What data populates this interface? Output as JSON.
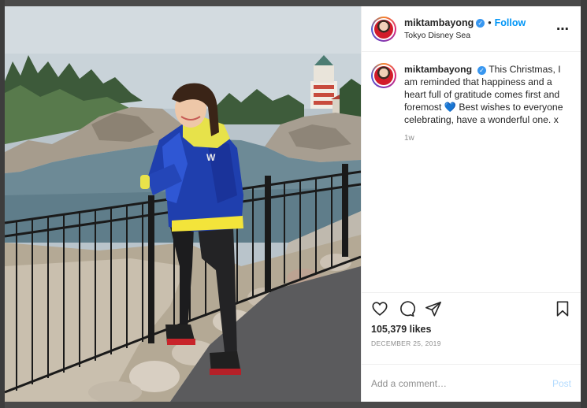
{
  "post": {
    "username": "miktambayong",
    "follow_label": "Follow",
    "location": "Tokyo Disney Sea",
    "more_icon": "more-options-icon",
    "caption_before_emoji": "This Christmas, I am reminded that happiness and a heart full of gratitude comes first and foremost",
    "caption_emoji": "💙",
    "caption_after_emoji": "Best wishes to everyone celebrating, have a wonderful one. x",
    "caption_time": "1w",
    "likes": "105,379 likes",
    "date": "DECEMBER 25, 2019",
    "comment_placeholder": "Add a comment…",
    "post_label": "Post",
    "jacket_text": "W",
    "icons": [
      "heart-icon",
      "comment-icon",
      "share-icon",
      "bookmark-icon"
    ],
    "accent": "#0095f6",
    "verified_color": "#3897f0"
  }
}
